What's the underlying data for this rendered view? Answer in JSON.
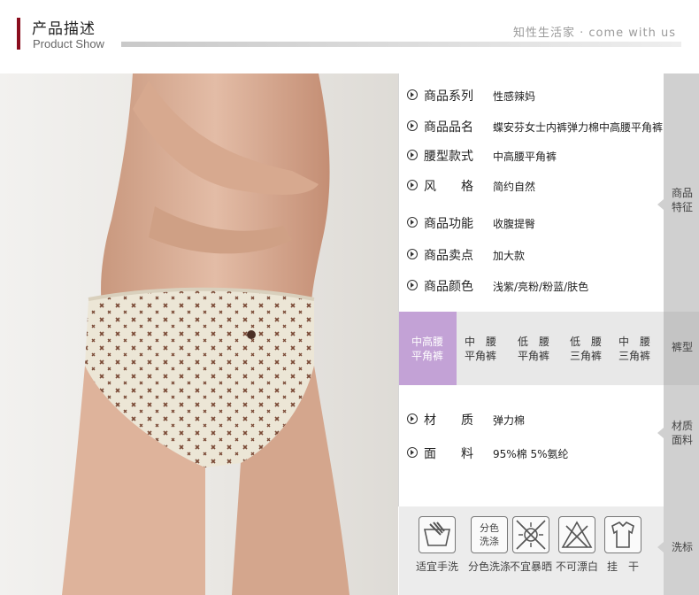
{
  "header": {
    "title": "产品描述",
    "subtitle": "Product Show",
    "slogan": "知性生活家 · come with us"
  },
  "features": {
    "side_label": "商品特征",
    "items": [
      {
        "label": "商品系列",
        "value": "性感辣妈"
      },
      {
        "label": "商品品名",
        "value": "蝶安芬女士内裤弹力棉中高腰平角裤"
      },
      {
        "label": "腰型款式",
        "value": "中高腰平角裤"
      },
      {
        "label": "风　　格",
        "value": "简约自然"
      },
      {
        "label": "商品功能",
        "value": "收腹提臀"
      },
      {
        "label": "商品卖点",
        "value": "加大款"
      },
      {
        "label": "商品颜色",
        "value": "浅紫/亮粉/粉蓝/肤色"
      }
    ]
  },
  "waist": {
    "side_label": "裤型",
    "options": [
      {
        "line1": "中高腰",
        "line2": "平角裤",
        "selected": true
      },
      {
        "line1": "中　腰",
        "line2": "平角裤",
        "selected": false
      },
      {
        "line1": "低　腰",
        "line2": "平角裤",
        "selected": false
      },
      {
        "line1": "低　腰",
        "line2": "三角裤",
        "selected": false
      },
      {
        "line1": "中　腰",
        "line2": "三角裤",
        "selected": false
      }
    ],
    "selected_color": "#c3a2d6"
  },
  "material": {
    "side_label": "材质面料",
    "items": [
      {
        "label": "材　　质",
        "value": "弹力棉"
      },
      {
        "label": "面　　料",
        "value": "95%棉 5%氨纶"
      }
    ]
  },
  "care": {
    "side_label": "洗标",
    "items": [
      {
        "icon": "hand-wash-icon",
        "caption": "适宜手洗",
        "text": ""
      },
      {
        "icon": "separate-wash-icon",
        "caption": "分色洗涤",
        "text": "分色洗涤"
      },
      {
        "icon": "no-sun-icon",
        "caption": "不宜暴晒",
        "text": ""
      },
      {
        "icon": "no-bleach-icon",
        "caption": "不可漂白",
        "text": ""
      },
      {
        "icon": "hang-dry-icon",
        "caption": "挂　干",
        "text": ""
      }
    ]
  }
}
